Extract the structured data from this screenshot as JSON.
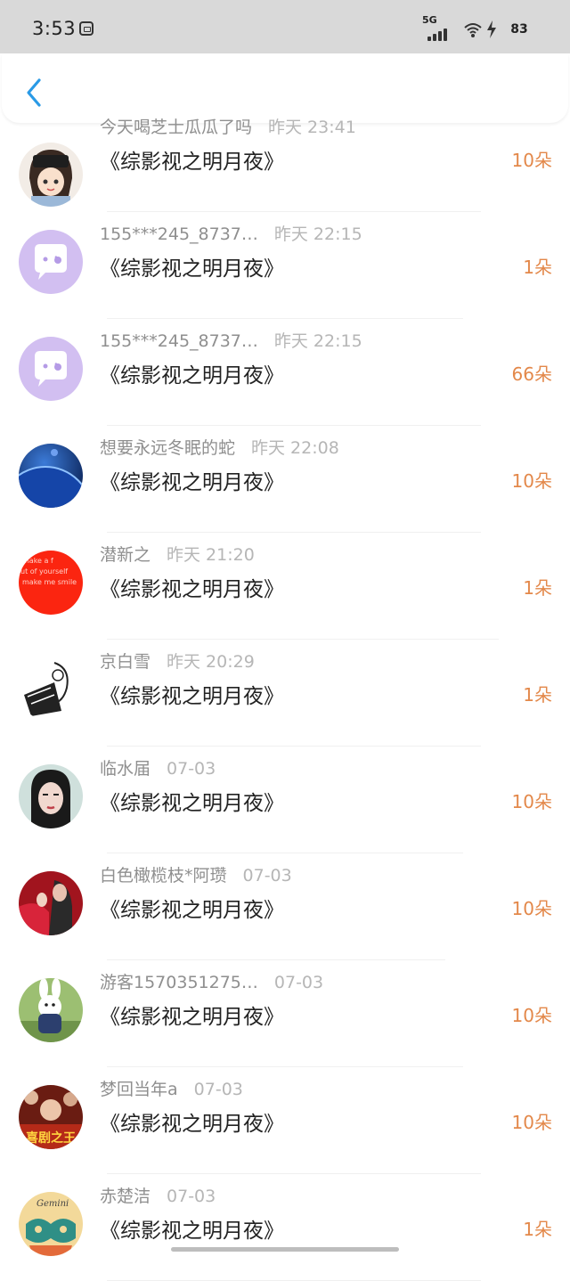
{
  "status_bar": {
    "time": "3:53",
    "network": "5G",
    "battery": "83"
  },
  "nav": {
    "back_icon": "chevron-left-icon"
  },
  "colors": {
    "accent": "#2a9ae6",
    "amount": "#e3884a",
    "name": "#8f8f8f",
    "time": "#b6b6b6"
  },
  "entries": [
    {
      "name": "今天喝芝士瓜瓜了吗",
      "time": "昨天 23:41",
      "book": "《综影视之明月夜》",
      "amount": "10朵",
      "avatar": "cartoon-girl-avatar"
    },
    {
      "name": "155***245_8737…",
      "time": "昨天 22:15",
      "book": "《综影视之明月夜》",
      "amount": "1朵",
      "avatar": "default-chat-avatar"
    },
    {
      "name": "155***245_8737…",
      "time": "昨天 22:15",
      "book": "《综影视之明月夜》",
      "amount": "66朵",
      "avatar": "default-chat-avatar"
    },
    {
      "name": "想要永远冬眠的蛇",
      "time": "昨天 22:08",
      "book": "《综影视之明月夜》",
      "amount": "10朵",
      "avatar": "blue-planet-avatar"
    },
    {
      "name": "潜新之",
      "time": "昨天 21:20",
      "book": "《综影视之明月夜》",
      "amount": "1朵",
      "avatar": "red-text-avatar"
    },
    {
      "name": "京白雪",
      "time": "昨天 20:29",
      "book": "《综影视之明月夜》",
      "amount": "1朵",
      "avatar": "sketch-avatar"
    },
    {
      "name": "临水届",
      "time": "07-03",
      "book": "《综影视之明月夜》",
      "amount": "10朵",
      "avatar": "portrait-avatar"
    },
    {
      "name": "白色橄榄枝*阿瓒",
      "time": "07-03",
      "book": "《综影视之明月夜》",
      "amount": "10朵",
      "avatar": "couple-avatar"
    },
    {
      "name": "游客1570351275…",
      "time": "07-03",
      "book": "《综影视之明月夜》",
      "amount": "10朵",
      "avatar": "rabbit-avatar"
    },
    {
      "name": "梦回当年a",
      "time": "07-03",
      "book": "《综影视之明月夜》",
      "amount": "10朵",
      "avatar": "poster-avatar"
    },
    {
      "name": "赤楚洁",
      "time": "07-03",
      "book": "《综影视之明月夜》",
      "amount": "1朵",
      "avatar": "gemini-avatar"
    }
  ]
}
